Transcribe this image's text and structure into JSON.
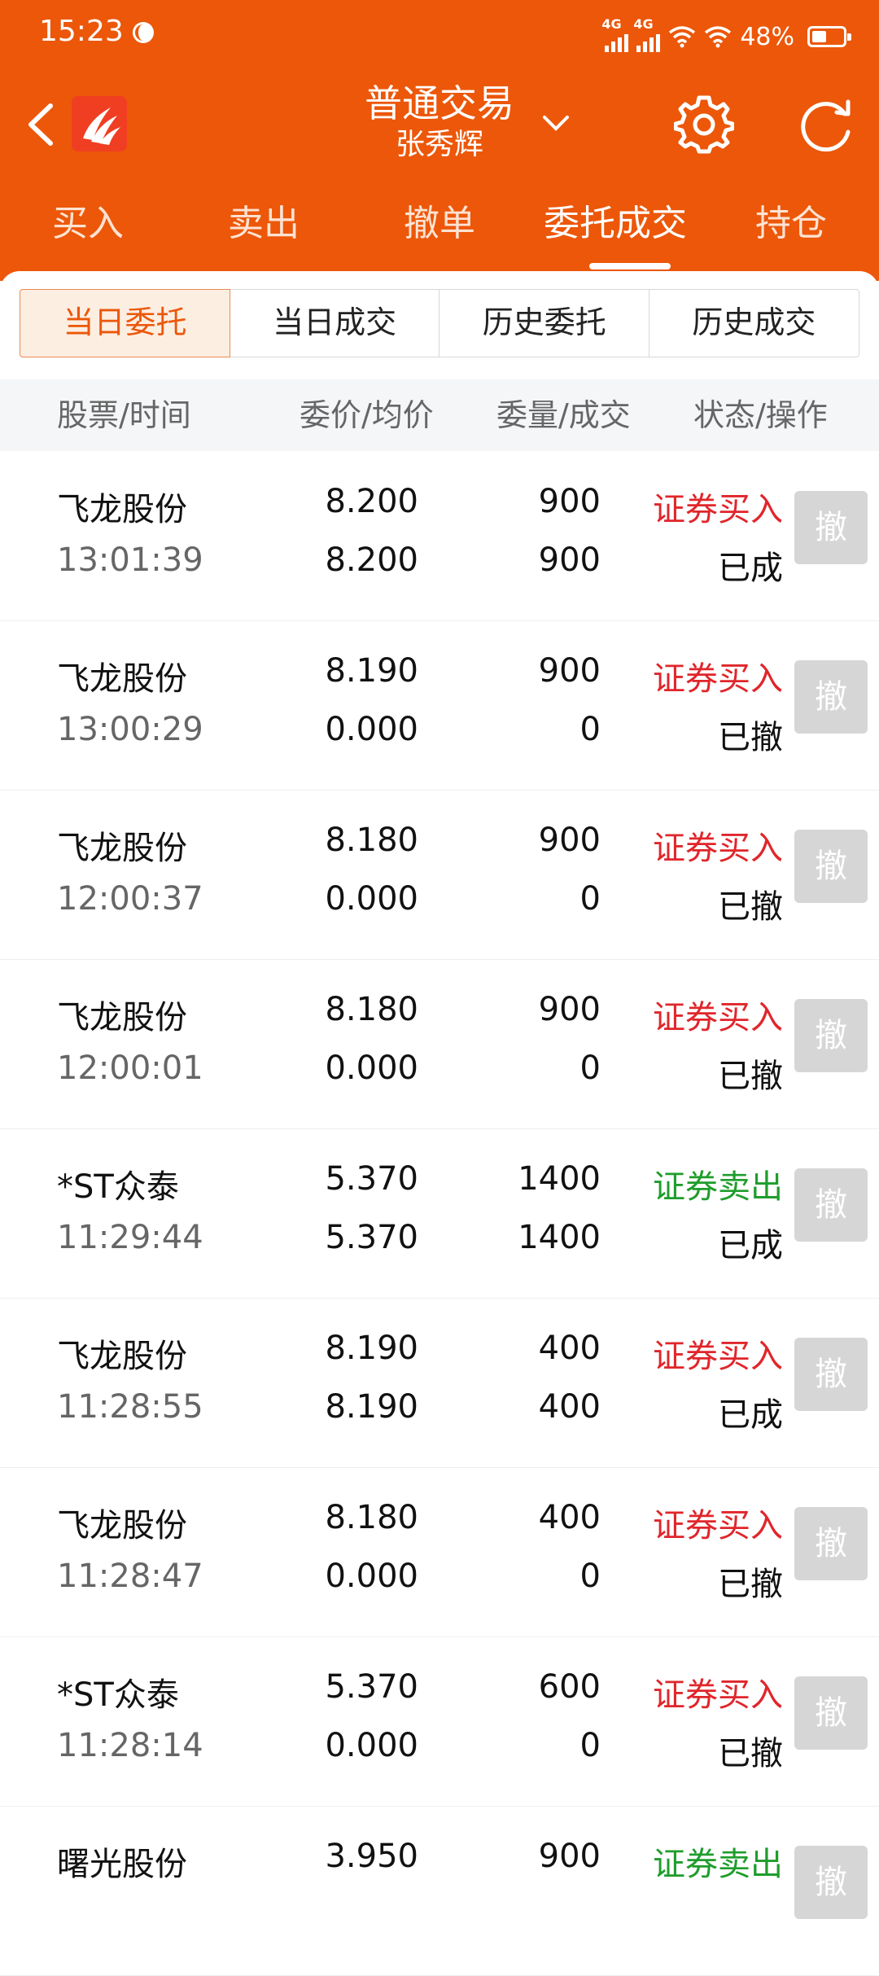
{
  "statusbar": {
    "time": "15:23",
    "net1": "4G",
    "net2": "4G",
    "battery": "48%"
  },
  "header": {
    "title": "普通交易",
    "subtitle": "张秀辉"
  },
  "main_tabs": [
    "买入",
    "卖出",
    "撤单",
    "委托成交",
    "持仓"
  ],
  "sub_tabs": [
    "当日委托",
    "当日成交",
    "历史委托",
    "历史成交"
  ],
  "columns": {
    "stock": "股票/时间",
    "price": "委价/均价",
    "qty": "委量/成交",
    "status": "状态/操作"
  },
  "colors": {
    "brand": "#ec5709",
    "buy": "#e0262b",
    "sell": "#1f9d2c"
  },
  "cancel_label": "撤",
  "orders": [
    {
      "name": "飞龙股份",
      "time": "13:01:39",
      "price": "8.200",
      "avg": "8.200",
      "qty": "900",
      "deal": "900",
      "type": "证券买入",
      "side": "buy",
      "state": "已成"
    },
    {
      "name": "飞龙股份",
      "time": "13:00:29",
      "price": "8.190",
      "avg": "0.000",
      "qty": "900",
      "deal": "0",
      "type": "证券买入",
      "side": "buy",
      "state": "已撤"
    },
    {
      "name": "飞龙股份",
      "time": "12:00:37",
      "price": "8.180",
      "avg": "0.000",
      "qty": "900",
      "deal": "0",
      "type": "证券买入",
      "side": "buy",
      "state": "已撤"
    },
    {
      "name": "飞龙股份",
      "time": "12:00:01",
      "price": "8.180",
      "avg": "0.000",
      "qty": "900",
      "deal": "0",
      "type": "证券买入",
      "side": "buy",
      "state": "已撤"
    },
    {
      "name": "*ST众泰",
      "time": "11:29:44",
      "price": "5.370",
      "avg": "5.370",
      "qty": "1400",
      "deal": "1400",
      "type": "证券卖出",
      "side": "sell",
      "state": "已成"
    },
    {
      "name": "飞龙股份",
      "time": "11:28:55",
      "price": "8.190",
      "avg": "8.190",
      "qty": "400",
      "deal": "400",
      "type": "证券买入",
      "side": "buy",
      "state": "已成"
    },
    {
      "name": "飞龙股份",
      "time": "11:28:47",
      "price": "8.180",
      "avg": "0.000",
      "qty": "400",
      "deal": "0",
      "type": "证券买入",
      "side": "buy",
      "state": "已撤"
    },
    {
      "name": "*ST众泰",
      "time": "11:28:14",
      "price": "5.370",
      "avg": "0.000",
      "qty": "600",
      "deal": "0",
      "type": "证券买入",
      "side": "buy",
      "state": "已撤"
    },
    {
      "name": "曙光股份",
      "time": "",
      "price": "3.950",
      "avg": "",
      "qty": "900",
      "deal": "",
      "type": "证券卖出",
      "side": "sell",
      "state": ""
    }
  ]
}
